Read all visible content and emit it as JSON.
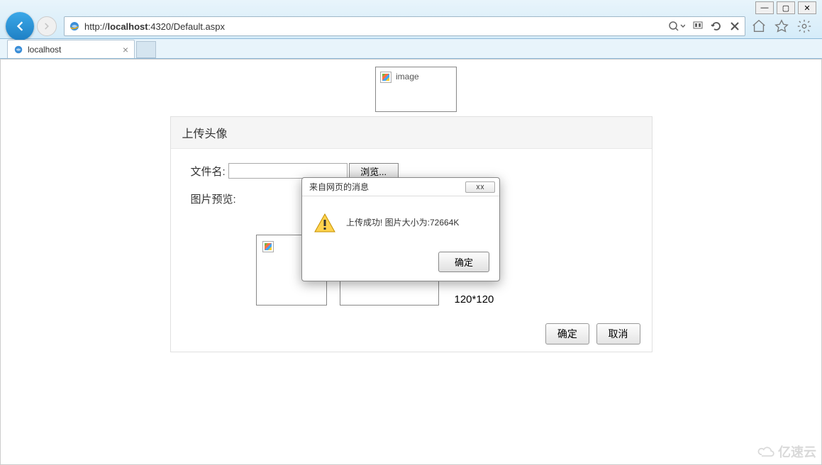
{
  "window": {
    "minimize": "—",
    "maximize": "▢",
    "close": "✕"
  },
  "browser": {
    "url_prefix": "http://",
    "url_host": "localhost",
    "url_port_path": ":4320/Default.aspx",
    "tab_title": "localhost"
  },
  "page": {
    "top_image_label": "image",
    "panel_title": "上传头像",
    "file_label": "文件名:",
    "browse_btn": "浏览...",
    "preview_label": "图片预览:",
    "size_label": "120*120",
    "ok_btn": "确定",
    "cancel_btn": "取消"
  },
  "alert": {
    "title": "来自网页的消息",
    "message": "上传成功! 图片大小为:72664K",
    "ok_btn": "确定"
  },
  "watermark": "亿速云"
}
